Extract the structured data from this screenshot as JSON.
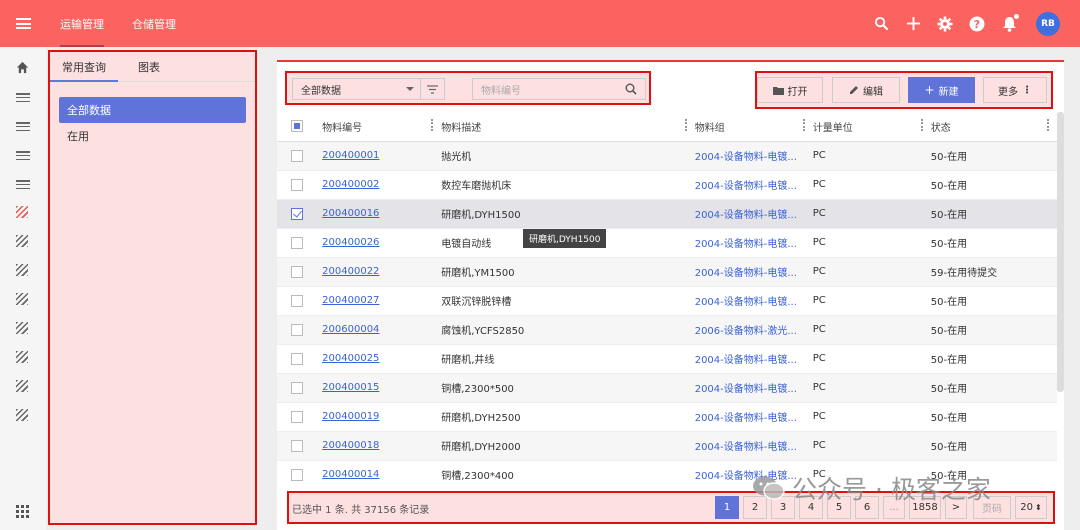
{
  "topbar": {
    "nav": [
      {
        "label": "运输管理",
        "active": true
      },
      {
        "label": "仓储管理",
        "active": false
      }
    ],
    "avatar": "RB",
    "icons": [
      "search-icon",
      "plus-icon",
      "gear-icon",
      "help-icon",
      "bell-icon"
    ]
  },
  "sidebar": {
    "tabs": [
      {
        "label": "常用查询",
        "active": true
      },
      {
        "label": "图表",
        "active": false
      }
    ],
    "items": [
      {
        "label": "全部数据",
        "active": true
      },
      {
        "label": "在用",
        "active": false
      }
    ]
  },
  "toolbar": {
    "select_value": "全部数据",
    "search_placeholder": "物料编号",
    "open_label": "打开",
    "edit_label": "编辑",
    "new_label": "新建",
    "more_label": "更多"
  },
  "table": {
    "columns": [
      "物料编号",
      "物料描述",
      "物料组",
      "计量单位",
      "状态"
    ],
    "rows": [
      {
        "code": "200400001",
        "desc": "抛光机",
        "group": "2004-设备物料-电镀...",
        "unit": "PC",
        "status": "50-在用",
        "checked": false
      },
      {
        "code": "200400002",
        "desc": "数控车磨抛机床",
        "group": "2004-设备物料-电镀...",
        "unit": "PC",
        "status": "50-在用",
        "checked": false
      },
      {
        "code": "200400016",
        "desc": "研磨机,DYH1500",
        "group": "2004-设备物料-电镀...",
        "unit": "PC",
        "status": "50-在用",
        "checked": true
      },
      {
        "code": "200400026",
        "desc": "电镀自动线",
        "group": "2004-设备物料-电镀...",
        "unit": "PC",
        "status": "50-在用",
        "checked": false
      },
      {
        "code": "200400022",
        "desc": "研磨机,YM1500",
        "group": "2004-设备物料-电镀...",
        "unit": "PC",
        "status": "59-在用待提交",
        "checked": false
      },
      {
        "code": "200400027",
        "desc": "双联沉锌脱锌槽",
        "group": "2004-设备物料-电镀...",
        "unit": "PC",
        "status": "50-在用",
        "checked": false
      },
      {
        "code": "200600004",
        "desc": "腐蚀机,YCFS2850",
        "group": "2006-设备物料-激光...",
        "unit": "PC",
        "status": "50-在用",
        "checked": false
      },
      {
        "code": "200400025",
        "desc": "研磨机,井线",
        "group": "2004-设备物料-电镀...",
        "unit": "PC",
        "status": "50-在用",
        "checked": false
      },
      {
        "code": "200400015",
        "desc": "铜槽,2300*500",
        "group": "2004-设备物料-电镀...",
        "unit": "PC",
        "status": "50-在用",
        "checked": false
      },
      {
        "code": "200400019",
        "desc": "研磨机,DYH2500",
        "group": "2004-设备物料-电镀...",
        "unit": "PC",
        "status": "50-在用",
        "checked": false
      },
      {
        "code": "200400018",
        "desc": "研磨机,DYH2000",
        "group": "2004-设备物料-电镀...",
        "unit": "PC",
        "status": "50-在用",
        "checked": false
      },
      {
        "code": "200400014",
        "desc": "铜槽,2300*400",
        "group": "2004-设备物料-电镀...",
        "unit": "PC",
        "status": "50-在用",
        "checked": false
      }
    ],
    "tooltip": "研磨机,DYH1500"
  },
  "footer": {
    "info": "已选中 1 条. 共 37156 条记录",
    "pages": [
      "1",
      "2",
      "3",
      "4",
      "5",
      "6",
      "...",
      "1858"
    ],
    "current_page": "1",
    "next": ">",
    "page_input_placeholder": "页码",
    "page_size": "20"
  },
  "watermark": {
    "text": "公众号 · 极客之家"
  }
}
